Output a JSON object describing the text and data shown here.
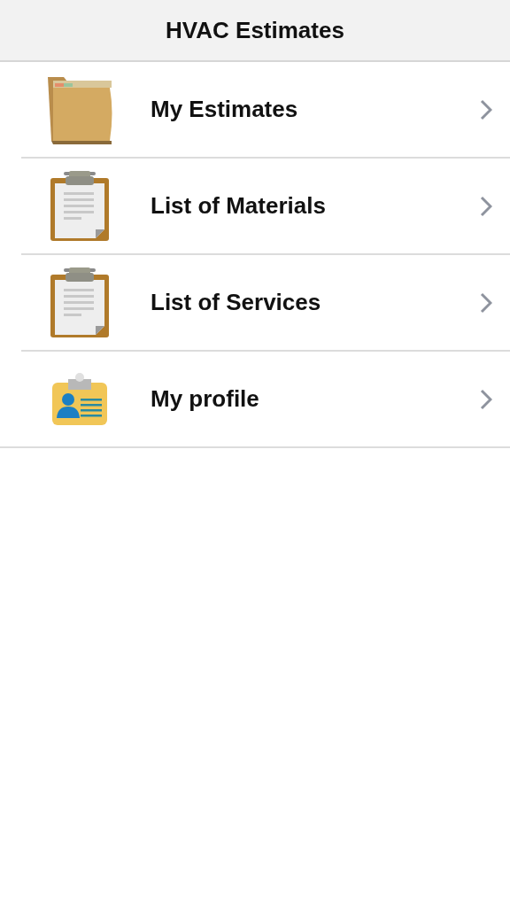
{
  "header": {
    "title": "HVAC Estimates"
  },
  "menu": [
    {
      "label": "My Estimates",
      "kind": "folder"
    },
    {
      "label": "List of Materials",
      "kind": "clipboard"
    },
    {
      "label": "List of Services",
      "kind": "clipboard"
    },
    {
      "label": "My profile",
      "kind": "idcard"
    }
  ]
}
